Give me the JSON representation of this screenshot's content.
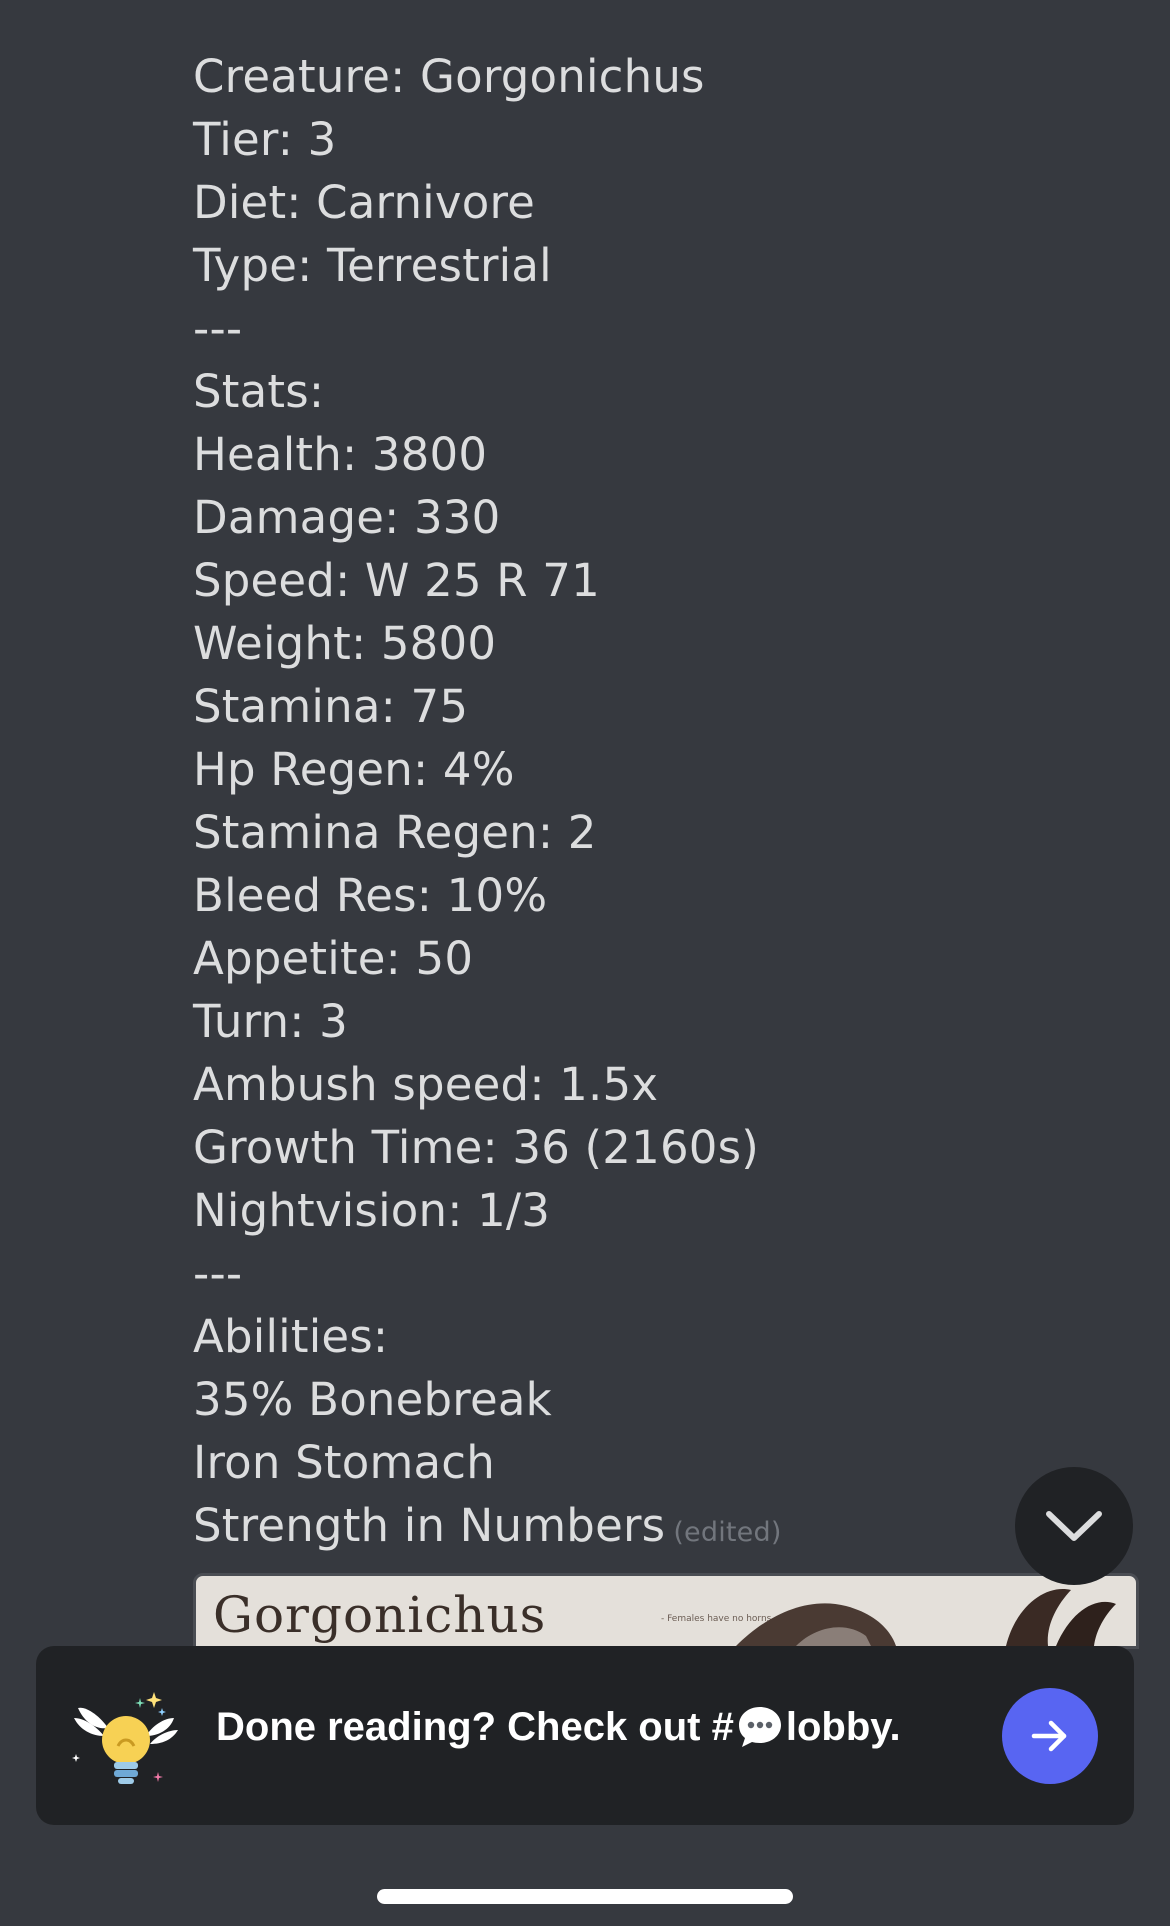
{
  "message": {
    "lines": [
      "Creature: Gorgonichus",
      "Tier: 3",
      "Diet: Carnivore",
      "Type: Terrestrial",
      "---",
      "Stats:",
      "Health: 3800",
      "Damage: 330",
      "Speed: W 25 R 71",
      "Weight: 5800",
      "Stamina: 75",
      "Hp Regen: 4%",
      "Stamina Regen: 2",
      "Bleed Res: 10%",
      "Appetite: 50",
      "Turn: 3",
      "Ambush speed: 1.5x",
      "Growth Time: 36 (2160s)",
      "Nightvision: 1/3",
      "---",
      "Abilities:",
      "35% Bonebreak",
      "Iron Stomach",
      "Strength in Numbers"
    ],
    "edited_label": "(edited)"
  },
  "embed": {
    "title": "Gorgonichus",
    "note": "- Females have no horns"
  },
  "banner": {
    "prefix": "Done reading? Check out #",
    "channel": "lobby.",
    "icon": "winged-lightbulb-icon",
    "button_icon": "arrow-right-icon"
  },
  "scroll_button": {
    "icon": "chevron-down-icon"
  },
  "colors": {
    "background": "#36393f",
    "banner_bg": "#202225",
    "accent": "#5865f2",
    "text": "#dcddde",
    "muted": "#72767d"
  }
}
